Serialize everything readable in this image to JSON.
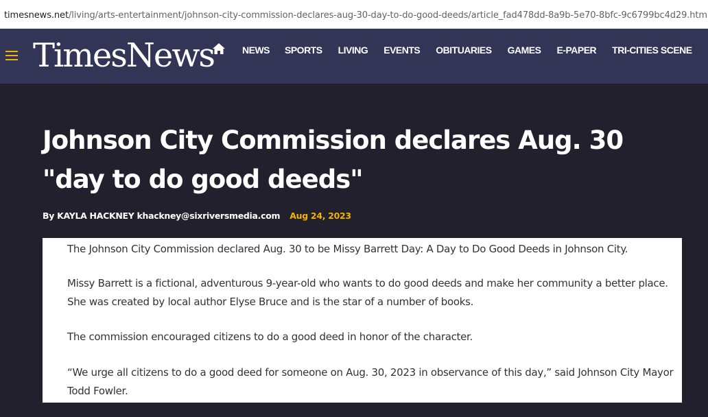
{
  "browser": {
    "url_domain": "timesnews.net",
    "url_path": "/living/arts-entertainment/johnson-city-commission-declares-aug-30-day-to-do-good-deeds/article_fad478dd-8a9b-5e70-8bfc-9c6799bc4d29.html"
  },
  "header": {
    "logo": "TimesNews",
    "menu_icon": "hamburger-menu-icon",
    "home_icon": "home-icon",
    "nav": [
      "NEWS",
      "SPORTS",
      "LIVING",
      "EVENTS",
      "OBITUARIES",
      "GAMES",
      "E-PAPER",
      "TRI-CITIES SCENE"
    ]
  },
  "article": {
    "title": "Johnson City Commission declares Aug. 30 \"day to do good deeds\"",
    "byline": "By KAYLA HACKNEY khackney@sixriversmedia.com",
    "date": "Aug 24, 2023",
    "paragraphs": [
      "The Johnson City Commission declared Aug. 30 to be Missy Barrett Day: A Day to Do Good Deeds in Johnson City.",
      "Missy Barrett is a fictional, adventurous 9-year-old who wants to do good deeds and make her community a better place. She was created by local author Elyse Bruce and is the star of a number of books.",
      "The commission encouraged citizens to do a good deed in honor of the character.",
      "“We urge all citizens to do a good deed for someone on Aug. 30, 2023 in observance of this day,” said Johnson City Mayor Todd Fowler."
    ]
  },
  "colors": {
    "navbar_bg": "#333556",
    "page_bg": "#22202c",
    "accent": "#f0b400"
  }
}
